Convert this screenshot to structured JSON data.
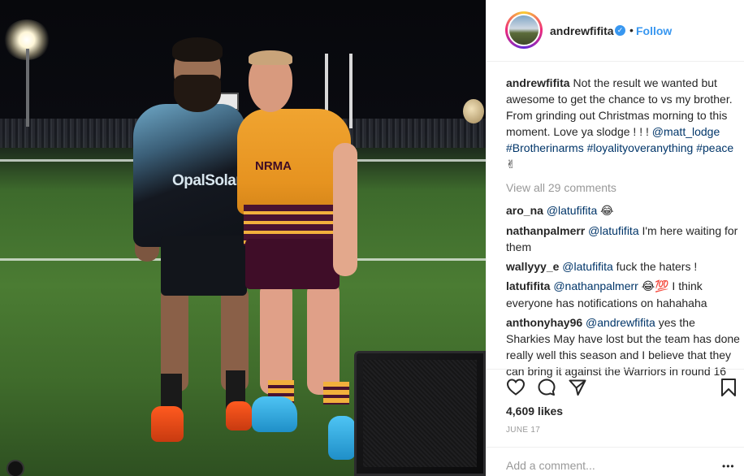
{
  "post": {
    "username": "andrewfifita",
    "verified_icon": "verified-badge-icon",
    "dot": "•",
    "follow_label": "Follow",
    "caption_user": "andrewfifita",
    "caption_text_1": " Not the result we wanted but awesome to get the chance to vs my brother. From grinding out Christmas morning to this moment. Love ya slodge ! ! ! ",
    "caption_mention": "@matt_lodge",
    "caption_tags": " #Brotherinarms #loyalityoveranything #peace",
    "caption_emoji": "✌",
    "view_all": "View all 29 comments",
    "likes": "4,609 likes",
    "date": "JUNE 17",
    "add_comment_placeholder": "Add a comment...",
    "more_label": "•••"
  },
  "photo": {
    "p1_sponsor": "OpalSolar",
    "p2_sponsor": "NRMA"
  },
  "comments": [
    {
      "user": "aro_na",
      "mention": "@latufifita",
      "text": " ",
      "emoji": "😂"
    },
    {
      "user": "nathanpalmerr",
      "mention": "@latufifita",
      "text": " I'm here waiting for them",
      "emoji": ""
    },
    {
      "user": "wallyyy_e",
      "mention": "@latufifita",
      "text": " fuck the haters !",
      "emoji": ""
    },
    {
      "user": "latufifita",
      "mention": "@nathanpalmerr",
      "text": " I think everyone has notifications on hahahaha",
      "emoji": "😂💯"
    },
    {
      "user": "anthonyhay96",
      "mention": "@andrewfifita",
      "text": " yes the Sharkies May have lost but the team has done really well this season and I believe that they can bring it against the Warriors in round 16",
      "emoji": ""
    }
  ],
  "icons": {
    "heart": "heart-icon",
    "comment": "comment-icon",
    "share": "share-icon",
    "save": "bookmark-icon"
  },
  "colors": {
    "link": "#3897f0",
    "mention": "#003569",
    "muted": "#999999"
  }
}
